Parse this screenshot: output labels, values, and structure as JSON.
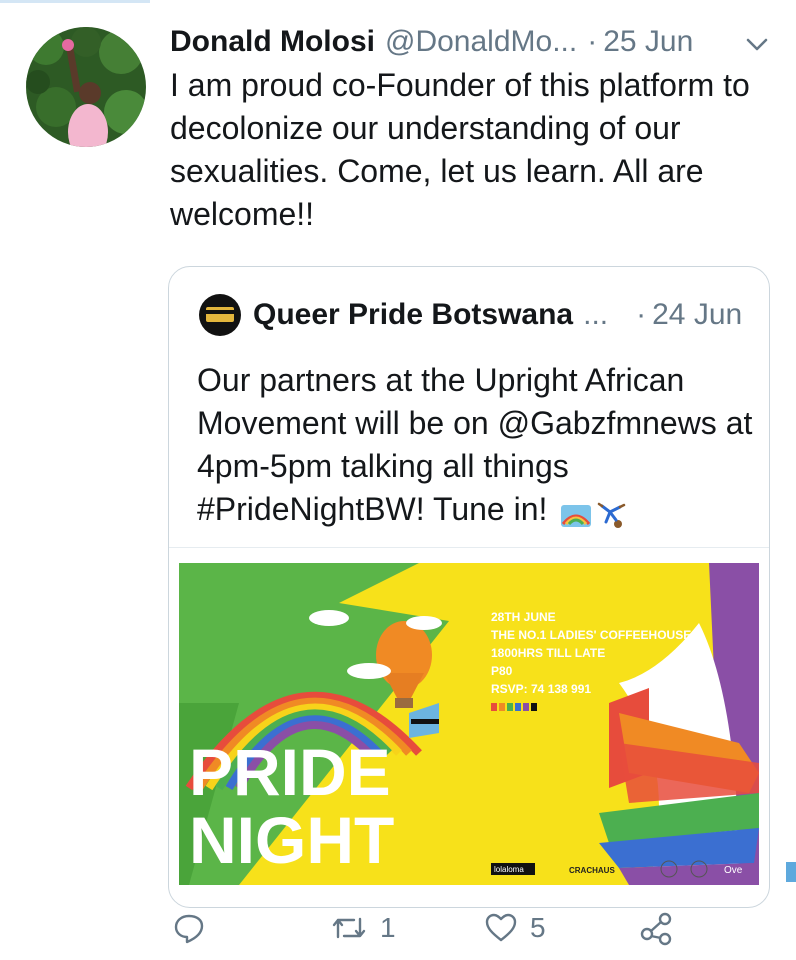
{
  "tweet": {
    "author_name": "Donald Molosi",
    "author_handle": "@DonaldMo...",
    "separator": "·",
    "date": "25 Jun",
    "text": "I am proud co-Founder of this platform to decolonize our understanding of our sexualities.  Come, let us learn. All are welcome!!"
  },
  "quoted_tweet": {
    "author_name": "Queer Pride Botswana",
    "ellipsis": "...",
    "separator": "·",
    "date": "24 Jun",
    "text": "Our partners at the Upright African Movement will be on @Gabzfmnews at 4pm-5pm talking all things #PrideNightBW! Tune in!",
    "emojis": [
      "rainbow-emoji",
      "person-cartwheeling-emoji"
    ]
  },
  "poster": {
    "title_line1": "PRIDE",
    "title_line2": "NIGHT",
    "date_line": "28TH JUNE",
    "venue": "THE NO.1 LADIES' COFFEEHOUSE",
    "time": "1800HRS TILL LATE",
    "price": "P80",
    "rsvp": "RSVP: 74 138 991",
    "sponsor_1": "lolaloma",
    "sponsor_2": "CRACHAUS",
    "sponsor_3": "Ove",
    "colors": {
      "green": "#5bb548",
      "yellow": "#f7e11a",
      "purple": "#8a4fa6"
    }
  },
  "actions": {
    "reply_count": "",
    "retweet_count": "1",
    "like_count": "5"
  },
  "icons": [
    "reply-icon",
    "retweet-icon",
    "like-icon",
    "share-icon",
    "chevron-down-icon"
  ],
  "colors": {
    "text": "#14171a",
    "secondary": "#657786",
    "border": "#ccd6dd"
  }
}
